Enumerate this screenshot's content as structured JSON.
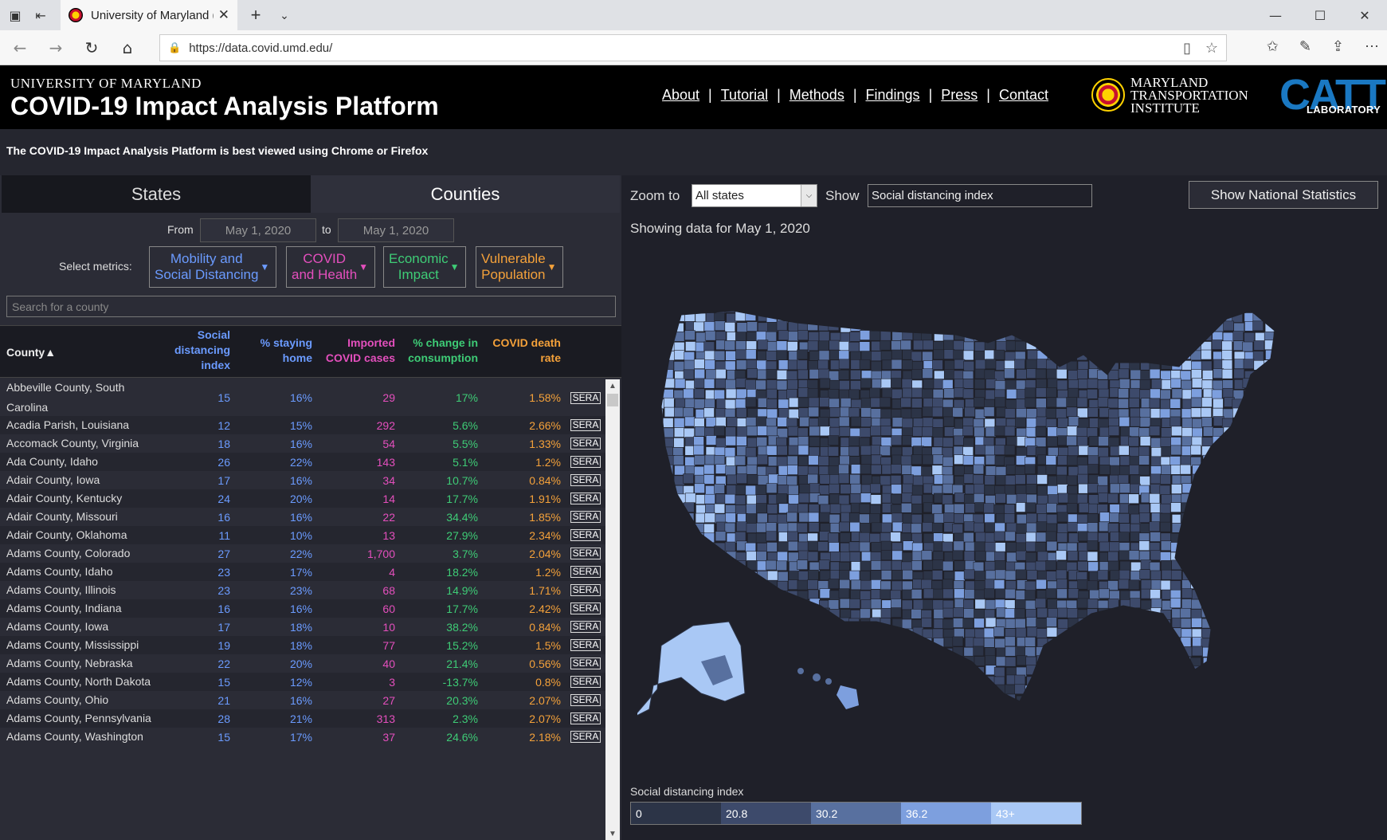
{
  "browser": {
    "tab_title": "University of Maryland (",
    "url": "https://data.covid.umd.edu/"
  },
  "header": {
    "university": "UNIVERSITY OF MARYLAND",
    "title": "COVID-19 Impact Analysis Platform",
    "nav": [
      "About",
      "Tutorial",
      "Methods",
      "Findings",
      "Press",
      "Contact"
    ],
    "mti_lines": [
      "MARYLAND",
      "TRANSPORTATION",
      "INSTITUTE"
    ],
    "catt_big": "CATT",
    "catt_small": "LABORATORY"
  },
  "notice": "The COVID-19 Impact Analysis Platform is best viewed using Chrome or Firefox",
  "left": {
    "tabs": [
      "States",
      "Counties"
    ],
    "active_tab": "Counties",
    "from_label": "From",
    "to_label": "to",
    "from_date": "May 1, 2020",
    "to_date": "May 1, 2020",
    "metrics_label": "Select metrics:",
    "metrics": [
      {
        "line1": "Mobility and",
        "line2": "Social Distancing",
        "color": "#6b9bff"
      },
      {
        "line1": "COVID",
        "line2": "and Health",
        "color": "#e44fbd"
      },
      {
        "line1": "Economic",
        "line2": "Impact",
        "color": "#3ecc76"
      },
      {
        "line1": "Vulnerable",
        "line2": "Population",
        "color": "#f4a13a"
      }
    ],
    "search_placeholder": "Search for a county",
    "columns": {
      "county": "County",
      "sdi": [
        "Social",
        "distancing",
        "index"
      ],
      "home": [
        "% staying",
        "home"
      ],
      "imported": [
        "Imported",
        "COVID cases"
      ],
      "consumption": [
        "% change in",
        "consumption"
      ],
      "death": [
        "COVID death",
        "rate"
      ]
    },
    "sera_label": "SERA",
    "rows": [
      {
        "name": "Abbeville County, South Carolina",
        "sdi": "15",
        "home": "16%",
        "imported": "29",
        "consumption": "17%",
        "death": "1.58%"
      },
      {
        "name": "Acadia Parish, Louisiana",
        "sdi": "12",
        "home": "15%",
        "imported": "292",
        "consumption": "5.6%",
        "death": "2.66%"
      },
      {
        "name": "Accomack County, Virginia",
        "sdi": "18",
        "home": "16%",
        "imported": "54",
        "consumption": "5.5%",
        "death": "1.33%"
      },
      {
        "name": "Ada County, Idaho",
        "sdi": "26",
        "home": "22%",
        "imported": "143",
        "consumption": "5.1%",
        "death": "1.2%"
      },
      {
        "name": "Adair County, Iowa",
        "sdi": "17",
        "home": "16%",
        "imported": "34",
        "consumption": "10.7%",
        "death": "0.84%"
      },
      {
        "name": "Adair County, Kentucky",
        "sdi": "24",
        "home": "20%",
        "imported": "14",
        "consumption": "17.7%",
        "death": "1.91%"
      },
      {
        "name": "Adair County, Missouri",
        "sdi": "16",
        "home": "16%",
        "imported": "22",
        "consumption": "34.4%",
        "death": "1.85%"
      },
      {
        "name": "Adair County, Oklahoma",
        "sdi": "11",
        "home": "10%",
        "imported": "13",
        "consumption": "27.9%",
        "death": "2.34%"
      },
      {
        "name": "Adams County, Colorado",
        "sdi": "27",
        "home": "22%",
        "imported": "1,700",
        "consumption": "3.7%",
        "death": "2.04%"
      },
      {
        "name": "Adams County, Idaho",
        "sdi": "23",
        "home": "17%",
        "imported": "4",
        "consumption": "18.2%",
        "death": "1.2%"
      },
      {
        "name": "Adams County, Illinois",
        "sdi": "23",
        "home": "23%",
        "imported": "68",
        "consumption": "14.9%",
        "death": "1.71%"
      },
      {
        "name": "Adams County, Indiana",
        "sdi": "16",
        "home": "16%",
        "imported": "60",
        "consumption": "17.7%",
        "death": "2.42%"
      },
      {
        "name": "Adams County, Iowa",
        "sdi": "17",
        "home": "18%",
        "imported": "10",
        "consumption": "38.2%",
        "death": "0.84%"
      },
      {
        "name": "Adams County, Mississippi",
        "sdi": "19",
        "home": "18%",
        "imported": "77",
        "consumption": "15.2%",
        "death": "1.5%"
      },
      {
        "name": "Adams County, Nebraska",
        "sdi": "22",
        "home": "20%",
        "imported": "40",
        "consumption": "21.4%",
        "death": "0.56%"
      },
      {
        "name": "Adams County, North Dakota",
        "sdi": "15",
        "home": "12%",
        "imported": "3",
        "consumption": "-13.7%",
        "death": "0.8%"
      },
      {
        "name": "Adams County, Ohio",
        "sdi": "21",
        "home": "16%",
        "imported": "27",
        "consumption": "20.3%",
        "death": "2.07%"
      },
      {
        "name": "Adams County, Pennsylvania",
        "sdi": "28",
        "home": "21%",
        "imported": "313",
        "consumption": "2.3%",
        "death": "2.07%"
      },
      {
        "name": "Adams County, Washington",
        "sdi": "15",
        "home": "17%",
        "imported": "37",
        "consumption": "24.6%",
        "death": "2.18%"
      }
    ]
  },
  "right": {
    "zoom_label": "Zoom to",
    "zoom_value": "All states",
    "show_label": "Show",
    "show_value": "Social distancing index",
    "national_button": "Show National Statistics",
    "showing_text": "Showing data for May 1, 2020",
    "legend_title": "Social distancing index",
    "legend": [
      {
        "label": "0",
        "color": "#2c3447"
      },
      {
        "label": "20.8",
        "color": "#3d4a6b"
      },
      {
        "label": "30.2",
        "color": "#58709f"
      },
      {
        "label": "36.2",
        "color": "#7d9fde"
      },
      {
        "label": "43+",
        "color": "#a9c8f5"
      }
    ]
  }
}
